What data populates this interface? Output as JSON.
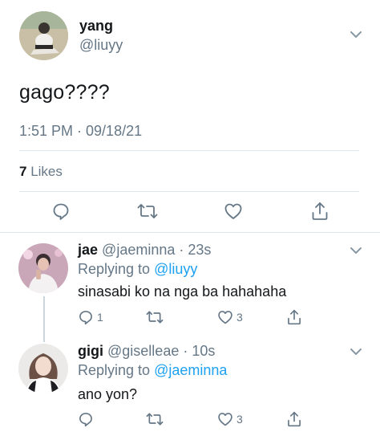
{
  "tweet": {
    "author_name": "yang",
    "author_handle": "@liuyy",
    "text": "gago????",
    "timestamp": "1:51 PM · 09/18/21",
    "likes_count": "7",
    "likes_label": "Likes"
  },
  "replies": [
    {
      "name": "jae",
      "handle_time": "@jaeminna · 23s",
      "replying_prefix": "Replying to",
      "replying_to": "@liuyy",
      "text": "sinasabi ko na nga ba hahahaha",
      "reply_count": "1",
      "like_count": "3"
    },
    {
      "name": "gigi",
      "handle_time": "@giselleae · 10s",
      "replying_prefix": "Replying to",
      "replying_to": "@jaeminna",
      "text": "ano yon?",
      "reply_count": "",
      "like_count": "3"
    }
  ],
  "colors": {
    "text_primary": "#14171a",
    "text_secondary": "#657786",
    "link": "#1da1f2",
    "divider": "#e1e8ed"
  },
  "icons": [
    "reply-icon",
    "retweet-icon",
    "like-icon",
    "share-icon",
    "chevron-down-icon"
  ]
}
